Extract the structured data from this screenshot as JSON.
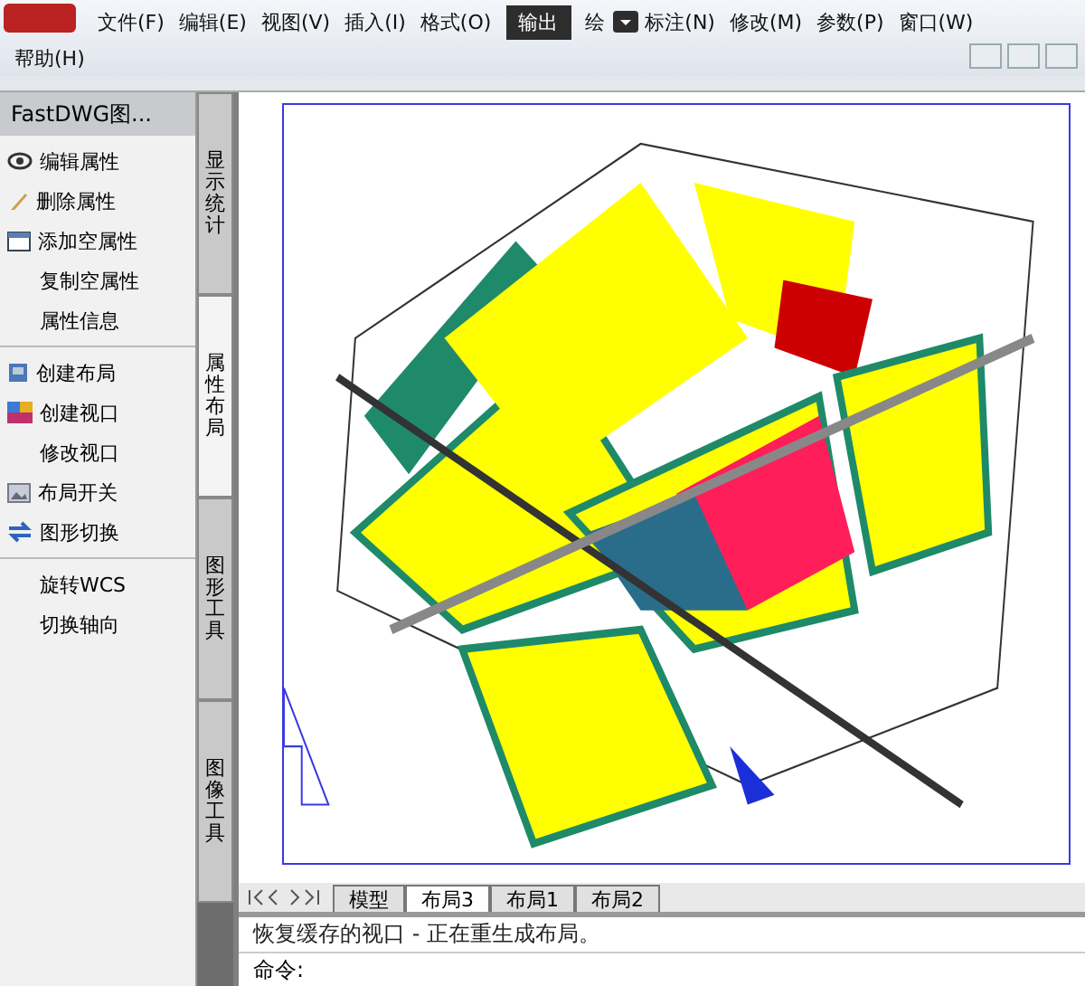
{
  "menu": [
    {
      "label": "文件(F)"
    },
    {
      "label": "编辑(E)"
    },
    {
      "label": "视图(V)"
    },
    {
      "label": "插入(I)"
    },
    {
      "label": "格式(O)"
    },
    {
      "label": "绘"
    },
    {
      "label": "标注(N)"
    },
    {
      "label": "修改(M)"
    },
    {
      "label": "参数(P)"
    },
    {
      "label": "窗口(W)"
    },
    {
      "label": "帮助(H)"
    }
  ],
  "tooltip": {
    "label": "输出"
  },
  "panel": {
    "title": "FastDWG图...",
    "groups": [
      [
        {
          "label": "编辑属性"
        },
        {
          "label": "删除属性"
        },
        {
          "label": "添加空属性"
        },
        {
          "label": "复制空属性"
        },
        {
          "label": "属性信息"
        }
      ],
      [
        {
          "label": "创建布局"
        },
        {
          "label": "创建视口"
        },
        {
          "label": "修改视口"
        },
        {
          "label": "布局开关"
        },
        {
          "label": "图形切换"
        }
      ],
      [
        {
          "label": "旋转WCS"
        },
        {
          "label": "切换轴向"
        }
      ]
    ]
  },
  "side_tabs": [
    {
      "label": "显示统计",
      "selected": false
    },
    {
      "label": "属性布局",
      "selected": true
    },
    {
      "label": "图形工具",
      "selected": false
    },
    {
      "label": "图像工具",
      "selected": false
    }
  ],
  "layout_tabs": [
    {
      "label": "模型",
      "selected": false
    },
    {
      "label": "布局3",
      "selected": true
    },
    {
      "label": "布局1",
      "selected": false
    },
    {
      "label": "布局2",
      "selected": false
    }
  ],
  "command": {
    "history": "恢复缓存的视口 - 正在重生成布局。",
    "prompt": "命令:"
  }
}
